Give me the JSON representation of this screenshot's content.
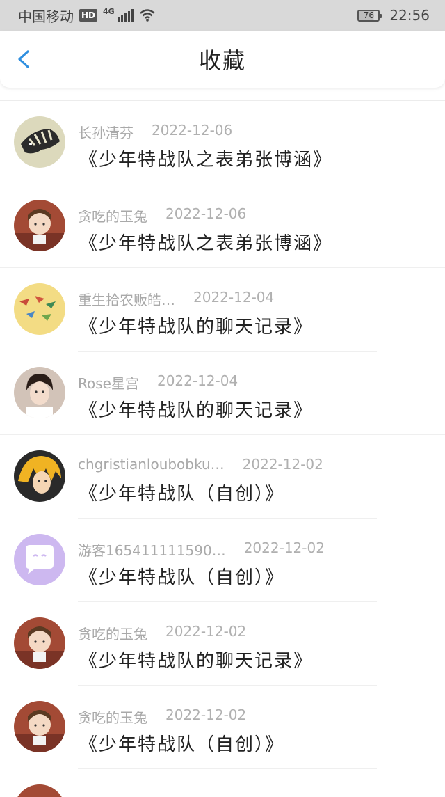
{
  "status_bar": {
    "carrier": "中国移动",
    "hd": "HD",
    "network": "4G",
    "battery": "76",
    "time": "22:56"
  },
  "header": {
    "title": "收藏"
  },
  "items": [
    {
      "user": "长孙清芬",
      "date": "2022-12-06",
      "title": "《少年特战队之表弟张博涵》",
      "avatar": "zebra",
      "avatar_color": "#d8d6b8"
    },
    {
      "user": "贪吃的玉兔",
      "date": "2022-12-06",
      "title": "《少年特战队之表弟张博涵》",
      "avatar": "girl",
      "avatar_color": "#9b3a2c"
    },
    {
      "user": "重生拾农贩皓…",
      "date": "2022-12-04",
      "title": "《少年特战队的聊天记录》",
      "avatar": "cranes",
      "avatar_color": "#f2d56b"
    },
    {
      "user": "Rose星宫",
      "date": "2022-12-04",
      "title": "《少年特战队的聊天记录》",
      "avatar": "portrait",
      "avatar_color": "#c9b6a8"
    },
    {
      "user": "chgristianloubobku…",
      "date": "2022-12-02",
      "title": "《少年特战队（自创）》",
      "avatar": "anime",
      "avatar_color": "#e0a22a"
    },
    {
      "user": "游客165411111590…",
      "date": "2022-12-02",
      "title": "《少年特战队（自创）》",
      "avatar": "chat",
      "avatar_color": "#cdb8f0"
    },
    {
      "user": "贪吃的玉兔",
      "date": "2022-12-02",
      "title": "《少年特战队的聊天记录》",
      "avatar": "girl",
      "avatar_color": "#9b3a2c"
    },
    {
      "user": "贪吃的玉兔",
      "date": "2022-12-02",
      "title": "《少年特战队（自创）》",
      "avatar": "girl",
      "avatar_color": "#9b3a2c"
    }
  ]
}
